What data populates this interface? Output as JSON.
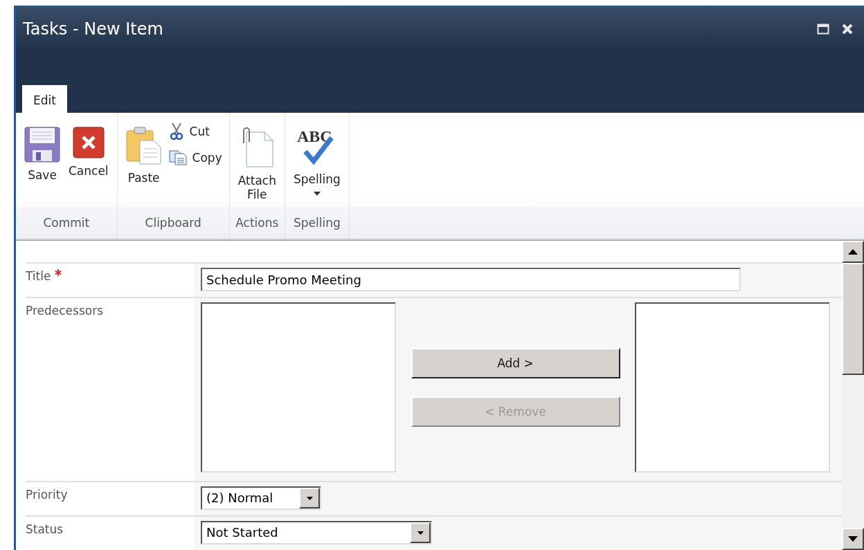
{
  "window": {
    "title": "Tasks - New Item"
  },
  "tabs": [
    {
      "label": "Edit",
      "selected": true
    }
  ],
  "ribbon_groups": [
    {
      "label": "Commit",
      "items": [
        {
          "kind": "large",
          "label": "Save"
        },
        {
          "kind": "large",
          "label": "Cancel"
        }
      ]
    },
    {
      "label": "Clipboard",
      "items": [
        {
          "kind": "large",
          "label": "Paste"
        },
        {
          "kind": "small",
          "label": "Cut"
        },
        {
          "kind": "small",
          "label": "Copy"
        }
      ]
    },
    {
      "label": "Actions",
      "items": [
        {
          "kind": "large",
          "label": "Attach\nFile"
        }
      ]
    },
    {
      "label": "Spelling",
      "items": [
        {
          "kind": "large",
          "label": "Spelling",
          "icon_text": "ABC",
          "dropdown": true
        }
      ]
    }
  ],
  "form": [
    {
      "kind": "text",
      "label": "Title",
      "required": true,
      "value": "Schedule Promo Meeting"
    },
    {
      "kind": "picker",
      "label": "Predecessors",
      "buttons": [
        {
          "label": "Add >",
          "disabled": false
        },
        {
          "label": "< Remove",
          "disabled": true
        }
      ]
    },
    {
      "kind": "select",
      "label": "Priority",
      "value": "(2) Normal"
    },
    {
      "kind": "select",
      "label": "Status",
      "value": "Not Started"
    }
  ]
}
